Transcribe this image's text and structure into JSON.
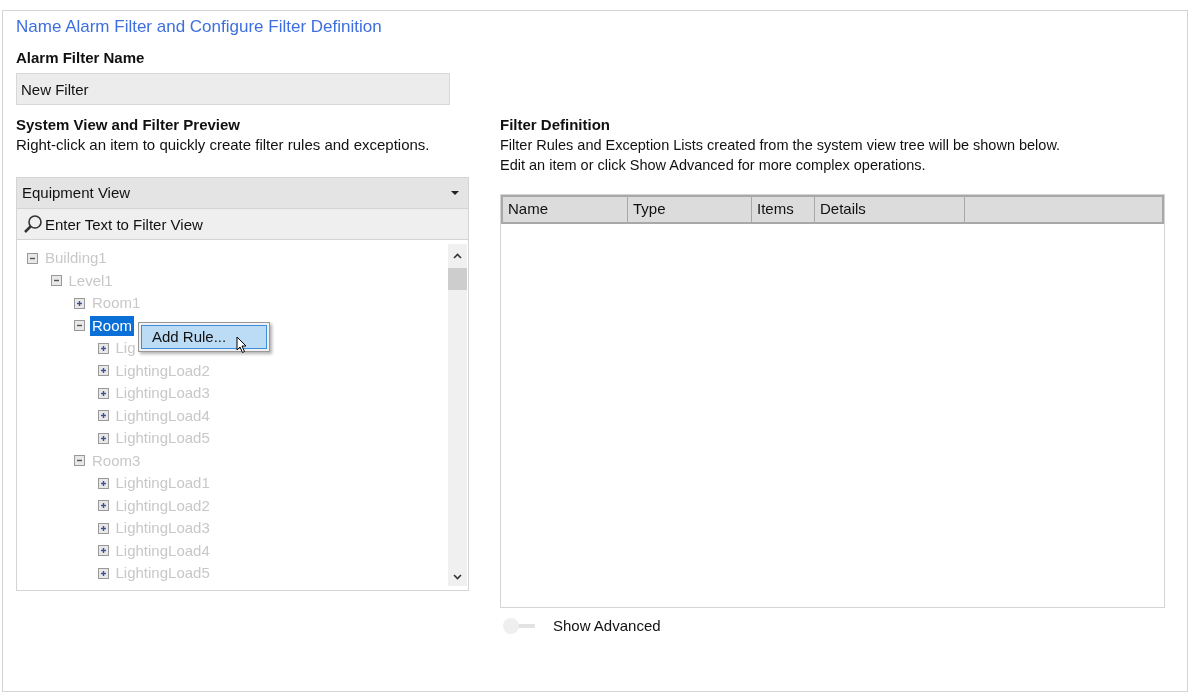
{
  "title": "Name Alarm Filter and Configure Filter Definition",
  "filter_name": {
    "label": "Alarm Filter Name",
    "value": "New Filter"
  },
  "system_view": {
    "heading": "System View and Filter Preview",
    "hint": "Right-click an item to quickly create filter rules and exceptions.",
    "view_dropdown": {
      "value": "Equipment View"
    },
    "search": {
      "placeholder": "Enter Text to Filter View"
    },
    "tree": [
      {
        "label": "Building1",
        "expanded": true,
        "selected": false,
        "children": [
          {
            "label": "Level1",
            "expanded": true,
            "selected": false,
            "children": [
              {
                "label": "Room1",
                "expanded": false,
                "selected": false
              },
              {
                "label": "Room",
                "expanded": true,
                "selected": true,
                "children": [
                  {
                    "label": "Lig",
                    "expanded": false,
                    "selected": false
                  },
                  {
                    "label": "LightingLoad2",
                    "expanded": false,
                    "selected": false
                  },
                  {
                    "label": "LightingLoad3",
                    "expanded": false,
                    "selected": false
                  },
                  {
                    "label": "LightingLoad4",
                    "expanded": false,
                    "selected": false
                  },
                  {
                    "label": "LightingLoad5",
                    "expanded": false,
                    "selected": false
                  }
                ]
              },
              {
                "label": "Room3",
                "expanded": true,
                "selected": false,
                "children": [
                  {
                    "label": "LightingLoad1",
                    "expanded": false,
                    "selected": false
                  },
                  {
                    "label": "LightingLoad2",
                    "expanded": false,
                    "selected": false
                  },
                  {
                    "label": "LightingLoad3",
                    "expanded": false,
                    "selected": false
                  },
                  {
                    "label": "LightingLoad4",
                    "expanded": false,
                    "selected": false
                  },
                  {
                    "label": "LightingLoad5",
                    "expanded": false,
                    "selected": false
                  }
                ]
              }
            ]
          }
        ]
      }
    ],
    "context_menu": {
      "items": [
        {
          "label": "Add Rule...",
          "selected": true
        }
      ]
    }
  },
  "filter_definition": {
    "heading": "Filter Definition",
    "hint_lines": [
      "Filter Rules and Exception Lists created from the system view tree will be shown below.",
      "Edit an item or click Show Advanced for more complex operations."
    ],
    "table": {
      "columns": [
        "Name",
        "Type",
        "Items",
        "Details"
      ]
    },
    "show_advanced": {
      "label": "Show Advanced",
      "on": false
    }
  }
}
